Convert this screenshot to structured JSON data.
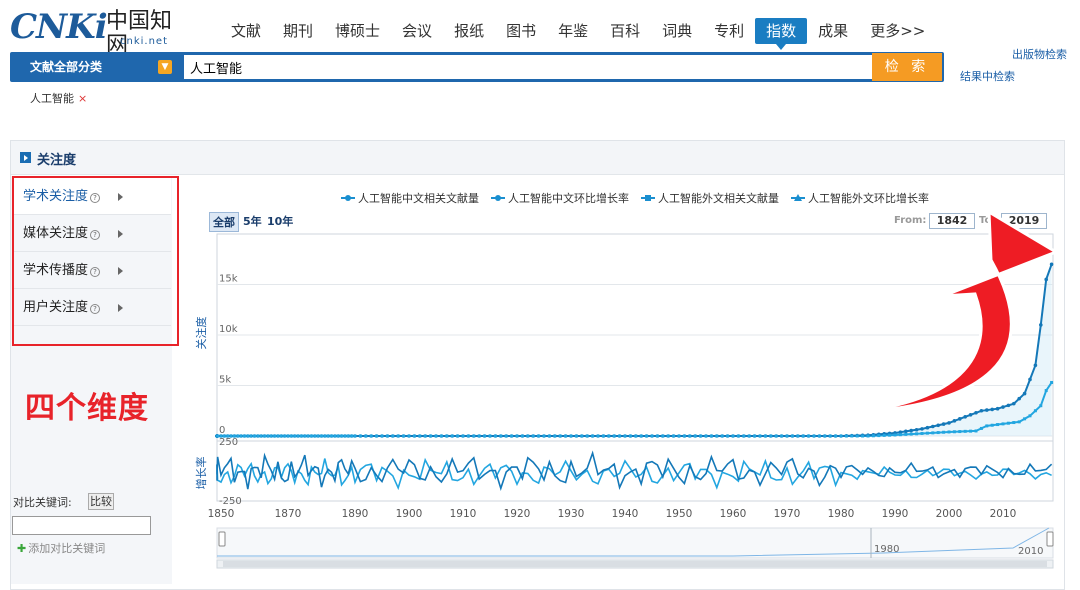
{
  "logo": {
    "cnki": "CNKi",
    "cn": "中国知网",
    "net": "cnki.net"
  },
  "nav": {
    "items": [
      "文献",
      "期刊",
      "博硕士",
      "会议",
      "报纸",
      "图书",
      "年鉴",
      "百科",
      "词典",
      "专利",
      "指数",
      "成果",
      "更多>>"
    ],
    "active": "指数"
  },
  "search": {
    "category_label": "文献全部分类",
    "value": "人工智能",
    "button_label": "检 索",
    "publication_search": "出版物检索",
    "search_in_results": "结果中检索"
  },
  "keyword_tag": "人工智能",
  "panel": {
    "title": "关注度",
    "side_items": [
      {
        "label": "学术关注度",
        "active": true
      },
      {
        "label": "媒体关注度",
        "active": false
      },
      {
        "label": "学术传播度",
        "active": false
      },
      {
        "label": "用户关注度",
        "active": false
      }
    ],
    "annotation": "四个维度",
    "compare_label": "对比关键词:",
    "compare_button": "比较",
    "compare_input": "",
    "add_compare": "添加对比关键词"
  },
  "chart_controls": {
    "ranges": [
      "全部",
      "5年",
      "10年"
    ],
    "active_range": "全部",
    "from_label": "From:",
    "to_label": "To:",
    "from_value": "1842",
    "to_value": "2019"
  },
  "chart_data": {
    "type": "line",
    "series": [
      {
        "name": "人工智能中文相关文献量",
        "marker": "circle"
      },
      {
        "name": "人工智能中文环比增长率",
        "marker": "diamond"
      },
      {
        "name": "人工智能外文相关文献量",
        "marker": "square"
      },
      {
        "name": "人工智能外文环比增长率",
        "marker": "triangle"
      }
    ],
    "upper_chart": {
      "ylabel": "关注度",
      "yticks": [
        "0",
        "5k",
        "10k",
        "15k"
      ],
      "ylim": [
        0,
        20000
      ],
      "chinese_docs": [
        [
          1842,
          0
        ],
        [
          1980,
          0
        ],
        [
          1985,
          80
        ],
        [
          1990,
          300
        ],
        [
          1995,
          700
        ],
        [
          2000,
          1300
        ],
        [
          2003,
          1900
        ],
        [
          2006,
          2500
        ],
        [
          2009,
          2700
        ],
        [
          2012,
          3200
        ],
        [
          2014,
          4200
        ],
        [
          2016,
          7000
        ],
        [
          2017,
          11000
        ],
        [
          2018,
          15500
        ],
        [
          2019,
          17000
        ]
      ],
      "foreign_docs": [
        [
          1842,
          0
        ],
        [
          1985,
          0
        ],
        [
          1990,
          100
        ],
        [
          1995,
          250
        ],
        [
          2000,
          400
        ],
        [
          2005,
          500
        ],
        [
          2007,
          1000
        ],
        [
          2010,
          1200
        ],
        [
          2013,
          1400
        ],
        [
          2015,
          2000
        ],
        [
          2017,
          3000
        ],
        [
          2018,
          4500
        ],
        [
          2019,
          5300
        ]
      ]
    },
    "lower_chart": {
      "ylabel": "增长率",
      "yticks": [
        "250",
        "-250"
      ],
      "ylim": [
        -250,
        250
      ]
    },
    "xticks": [
      "1850",
      "1870",
      "1890",
      "1900",
      "1910",
      "1920",
      "1930",
      "1940",
      "1950",
      "1960",
      "1970",
      "1980",
      "1990",
      "2000",
      "2010"
    ],
    "navigator_labels": [
      "1980",
      "2010"
    ]
  },
  "colors": {
    "line": "#1a8fd0",
    "nav_active": "#1a7dc2",
    "search_bar": "#1f67ad",
    "button": "#f59b23",
    "annotation": "#e8232a"
  }
}
